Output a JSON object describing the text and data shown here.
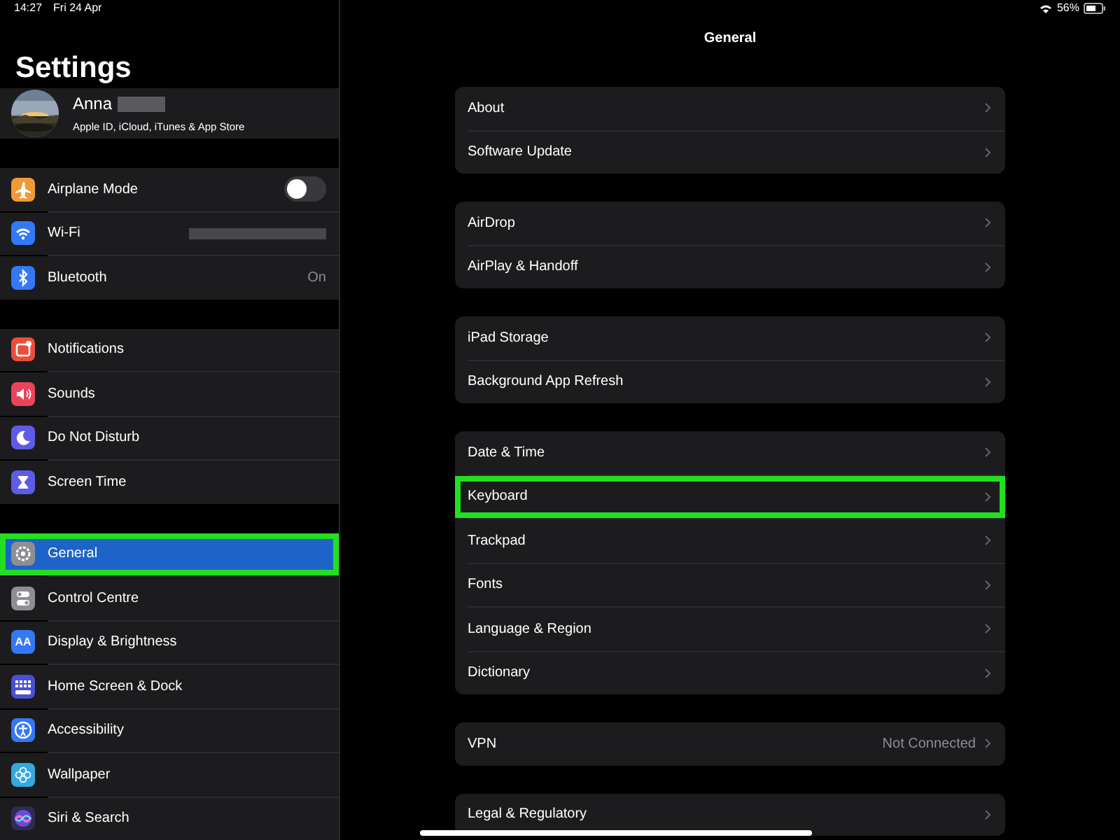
{
  "status_bar": {
    "time": "14:27",
    "date": "Fri 24 Apr",
    "battery": "56%"
  },
  "sidebar": {
    "title": "Settings",
    "profile": {
      "name": "Anna",
      "subtitle": "Apple ID, iCloud, iTunes & App Store",
      "name_redacted": true
    },
    "groups": [
      [
        {
          "label": "Airplane Mode",
          "color": "#f09a37",
          "toggle": {
            "on": false
          },
          "selected": false,
          "highlighted": false
        },
        {
          "label": "Wi-Fi",
          "color": "#3478f6",
          "value_redacted": true,
          "selected": false,
          "highlighted": false
        },
        {
          "label": "Bluetooth",
          "color": "#3478f6",
          "value": "On",
          "selected": false,
          "highlighted": false
        }
      ],
      [
        {
          "label": "Notifications",
          "color": "#eb4d3d",
          "selected": false,
          "highlighted": false
        },
        {
          "label": "Sounds",
          "color": "#eb445a",
          "selected": false,
          "highlighted": false
        },
        {
          "label": "Do Not Disturb",
          "color": "#5e5ce6",
          "selected": false,
          "highlighted": false
        },
        {
          "label": "Screen Time",
          "color": "#5e5ce6",
          "selected": false,
          "highlighted": false
        }
      ],
      [
        {
          "label": "General",
          "color": "#8e8e93",
          "selected": true,
          "highlighted": true
        },
        {
          "label": "Control Centre",
          "color": "#8e8e93",
          "selected": false,
          "highlighted": false
        },
        {
          "label": "Display & Brightness",
          "color": "#3478f6",
          "icon_text": "AA",
          "selected": false,
          "highlighted": false
        },
        {
          "label": "Home Screen & Dock",
          "color": "#4a4fd6",
          "selected": false,
          "highlighted": false
        },
        {
          "label": "Accessibility",
          "color": "#3478f6",
          "selected": false,
          "highlighted": false
        },
        {
          "label": "Wallpaper",
          "color": "#35aadc",
          "selected": false,
          "highlighted": false
        },
        {
          "label": "Siri & Search",
          "color": "#2c2c54",
          "selected": false,
          "highlighted": false
        }
      ]
    ]
  },
  "detail": {
    "title": "General",
    "groups": [
      [
        {
          "label": "About",
          "highlighted": false
        },
        {
          "label": "Software Update",
          "highlighted": false
        }
      ],
      [
        {
          "label": "AirDrop",
          "highlighted": false
        },
        {
          "label": "AirPlay & Handoff",
          "highlighted": false
        }
      ],
      [
        {
          "label": "iPad Storage",
          "highlighted": false
        },
        {
          "label": "Background App Refresh",
          "highlighted": false
        }
      ],
      [
        {
          "label": "Date & Time",
          "highlighted": false
        },
        {
          "label": "Keyboard",
          "highlighted": true
        },
        {
          "label": "Trackpad",
          "highlighted": false
        },
        {
          "label": "Fonts",
          "highlighted": false
        },
        {
          "label": "Language & Region",
          "highlighted": false
        },
        {
          "label": "Dictionary",
          "highlighted": false
        }
      ],
      [
        {
          "label": "VPN",
          "value": "Not Connected",
          "highlighted": false
        }
      ],
      [
        {
          "label": "Legal & Regulatory",
          "highlighted": false
        }
      ]
    ]
  }
}
